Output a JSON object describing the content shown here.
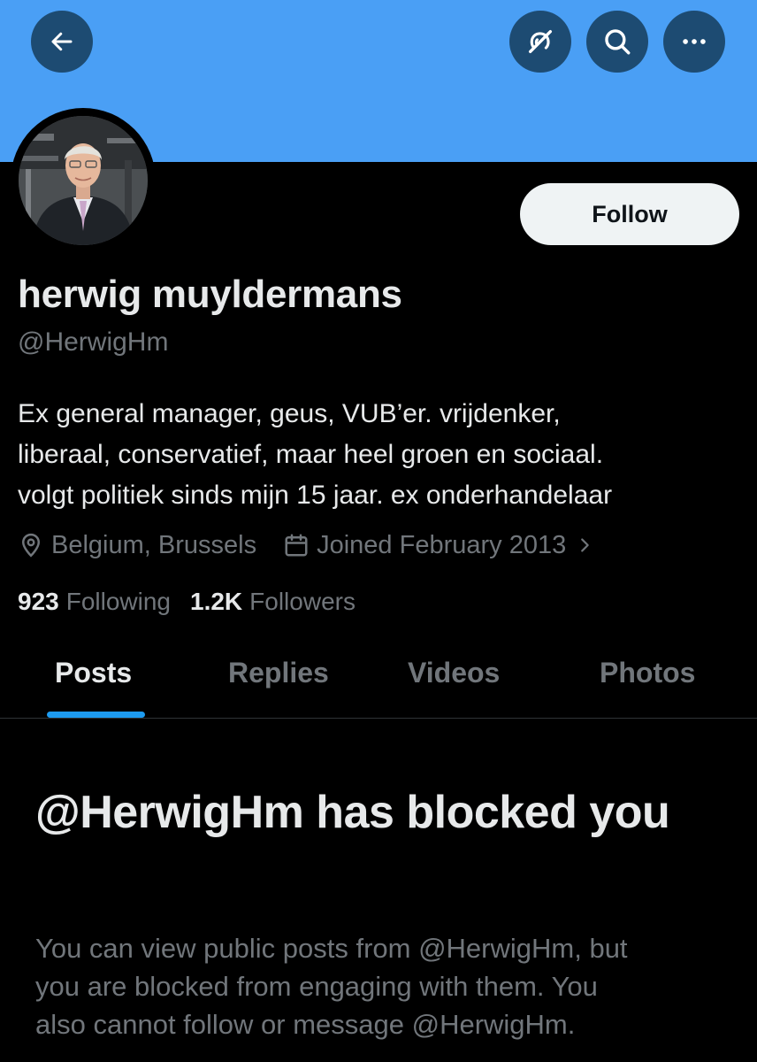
{
  "colors": {
    "banner": "#4a9ff5",
    "header_button_bg": "#1d4b72",
    "background": "#000000",
    "primary_text": "#e7e9ea",
    "secondary_text": "#71767b",
    "accent": "#1d9bf0",
    "follow_button_bg": "#eff3f4",
    "follow_button_text": "#0f1419"
  },
  "header": {
    "icons": [
      "back-arrow-icon",
      "satellite-off-icon",
      "search-icon",
      "more-icon"
    ]
  },
  "profile": {
    "follow_label": "Follow",
    "display_name": "herwig muyldermans",
    "handle": "@HerwigHm",
    "bio_lines": [
      "Ex general manager, geus, VUB’er. vrijdenker,",
      "liberaal, conservatief, maar heel groen en sociaal.",
      "volgt politiek sinds mijn 15 jaar. ex onderhandelaar"
    ],
    "location": "Belgium, Brussels",
    "joined": "Joined February 2013",
    "following_count": "923",
    "following_label": "Following",
    "followers_count": "1.2K",
    "followers_label": "Followers"
  },
  "tabs": [
    {
      "label": "Posts",
      "active": true
    },
    {
      "label": "Replies",
      "active": false
    },
    {
      "label": "Videos",
      "active": false
    },
    {
      "label": "Photos",
      "active": false
    }
  ],
  "blocked": {
    "title": "@HerwigHm has blocked you",
    "body_lines": [
      "You can view public posts from @HerwigHm, but",
      "you are blocked from engaging with them. You",
      "also cannot follow or message @HerwigHm."
    ]
  }
}
